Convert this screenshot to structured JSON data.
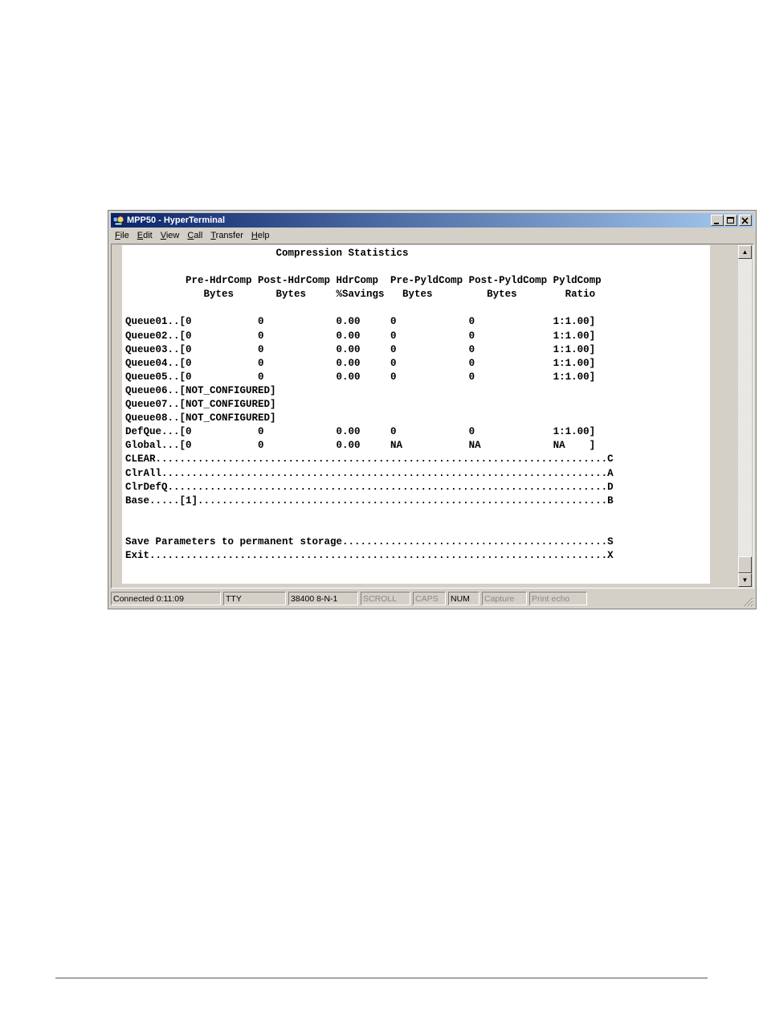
{
  "window": {
    "title": "MPP50 - HyperTerminal",
    "icon": "hyperterminal-icon",
    "controls": [
      "minimize-icon",
      "maximize-icon",
      "close-icon"
    ]
  },
  "menu": [
    {
      "accel": "F",
      "rest": "ile"
    },
    {
      "accel": "E",
      "rest": "dit"
    },
    {
      "accel": "V",
      "rest": "iew"
    },
    {
      "accel": "C",
      "rest": "all"
    },
    {
      "accel": "T",
      "rest": "ransfer"
    },
    {
      "accel": "H",
      "rest": "elp"
    }
  ],
  "terminal": {
    "lines": [
      "                         Compression Statistics",
      "",
      "          Pre-HdrComp Post-HdrComp HdrComp  Pre-PyldComp Post-PyldComp PyldComp",
      "             Bytes       Bytes     %Savings   Bytes         Bytes        Ratio",
      "",
      "Queue01..[0           0            0.00     0            0             1:1.00]",
      "Queue02..[0           0            0.00     0            0             1:1.00]",
      "Queue03..[0           0            0.00     0            0             1:1.00]",
      "Queue04..[0           0            0.00     0            0             1:1.00]",
      "Queue05..[0           0            0.00     0            0             1:1.00]",
      "Queue06..[NOT_CONFIGURED]",
      "Queue07..[NOT_CONFIGURED]",
      "Queue08..[NOT_CONFIGURED]",
      "DefQue...[0           0            0.00     0            0             1:1.00]",
      "Global...[0           0            0.00     NA           NA            NA    ]",
      "CLEAR...........................................................................C",
      "ClrAll..........................................................................A",
      "ClrDefQ.........................................................................D",
      "Base.....[1]....................................................................B",
      "",
      "",
      "Save Parameters to permanent storage............................................S",
      "Exit............................................................................X"
    ]
  },
  "scrollbar": {
    "up": "▲",
    "down": "▼"
  },
  "status": {
    "connected": "Connected 0:11:09",
    "emulation": "TTY",
    "port": "38400 8-N-1",
    "scroll": "SCROLL",
    "caps": "CAPS",
    "num": "NUM",
    "capture": "Capture",
    "print_echo": "Print echo"
  }
}
